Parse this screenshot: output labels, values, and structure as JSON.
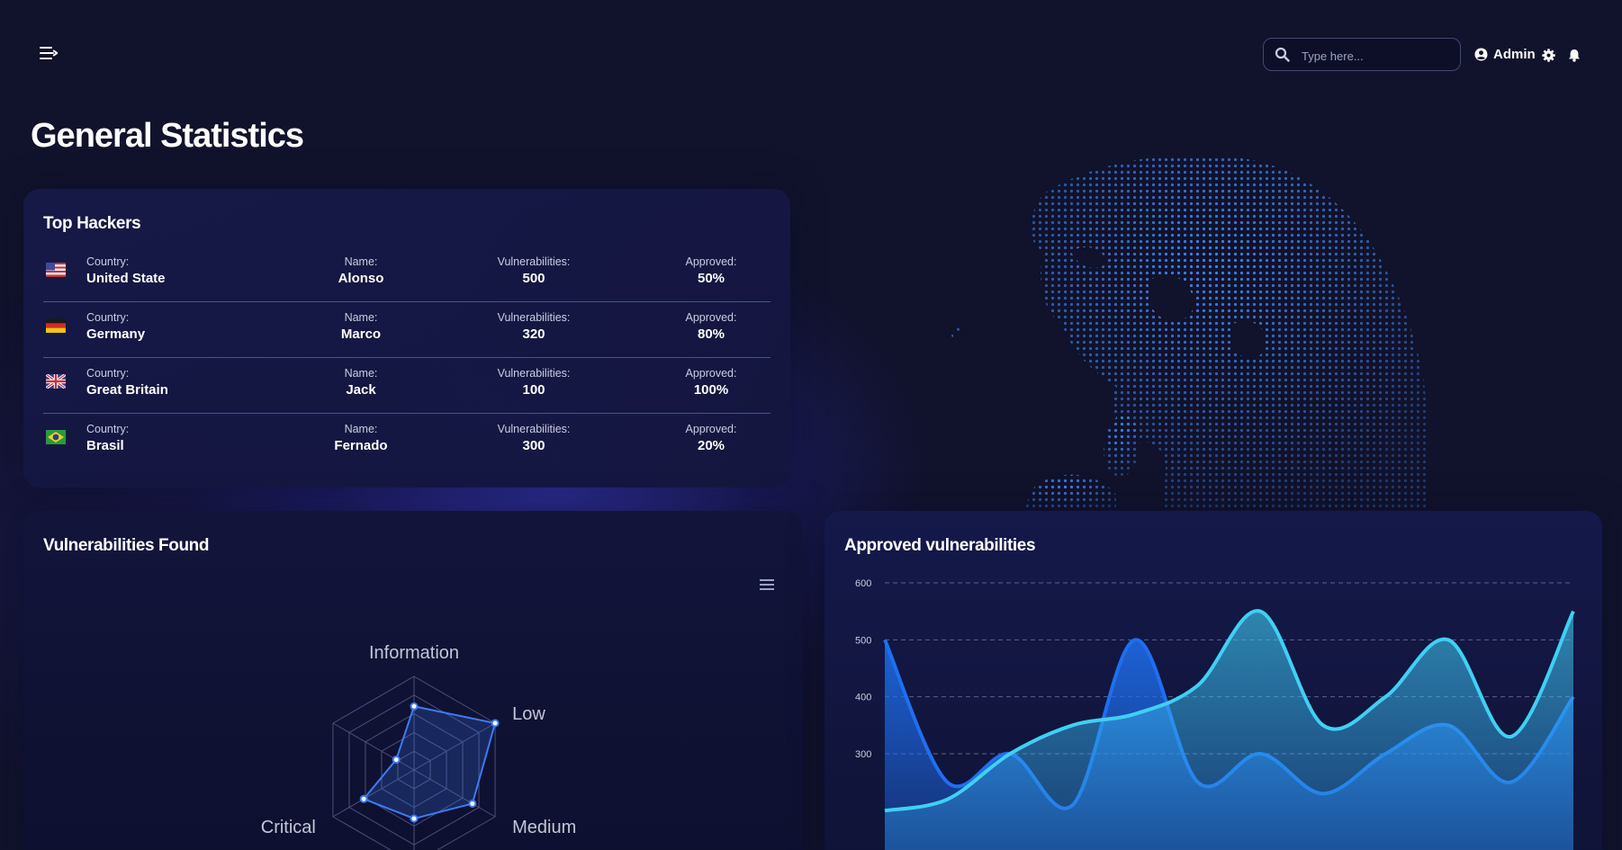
{
  "header": {
    "search": {
      "placeholder": "Type here..."
    },
    "user_label": "Admin"
  },
  "page_title": "General Statistics",
  "top_hackers": {
    "title": "Top Hackers",
    "labels": {
      "country": "Country:",
      "name": "Name:",
      "vulnerabilities": "Vulnerabilities:",
      "approved": "Approved:"
    },
    "rows": [
      {
        "flag": "us-flag-icon",
        "country": "United State",
        "name": "Alonso",
        "vulnerabilities": "500",
        "approved": "50%"
      },
      {
        "flag": "de-flag-icon",
        "country": "Germany",
        "name": "Marco",
        "vulnerabilities": "320",
        "approved": "80%"
      },
      {
        "flag": "gb-flag-icon",
        "country": "Great Britain",
        "name": "Jack",
        "vulnerabilities": "100",
        "approved": "100%"
      },
      {
        "flag": "br-flag-icon",
        "country": "Brasil",
        "name": "Fernado",
        "vulnerabilities": "300",
        "approved": "20%"
      }
    ]
  },
  "vulnerabilities_found": {
    "title": "Vulnerabilities Found",
    "menu_icon": "hamburger-icon"
  },
  "approved_vulnerabilities": {
    "title": "Approved vulnerabilities"
  },
  "colors": {
    "accent_blue": "#3d7bf5",
    "accent_cyan": "#3fd0f5",
    "card_bg": "#161848",
    "page_bg": "#11122b"
  },
  "chart_data": [
    {
      "type": "radar",
      "axes": [
        "Information",
        "Low",
        "Medium",
        "",
        "Critical",
        ""
      ],
      "levels": 5,
      "max": 5,
      "series": [
        {
          "values": [
            3.4,
            5.0,
            3.6,
            2.6,
            3.1,
            1.1
          ]
        }
      ]
    },
    {
      "type": "area",
      "title": "Approved vulnerabilities",
      "ylim": [
        200,
        600
      ],
      "yticks": [
        600,
        500,
        400,
        300
      ],
      "grid": true,
      "x": [
        0,
        1,
        2,
        3,
        4,
        5,
        6,
        7,
        8,
        9,
        10,
        11
      ],
      "series": [
        {
          "color": "#1e6ff0",
          "values": [
            500,
            250,
            300,
            210,
            500,
            250,
            300,
            230,
            300,
            350,
            250,
            400
          ]
        },
        {
          "color": "#3fd0f5",
          "values": [
            200,
            220,
            300,
            350,
            370,
            420,
            550,
            350,
            400,
            500,
            330,
            550
          ]
        }
      ]
    }
  ]
}
